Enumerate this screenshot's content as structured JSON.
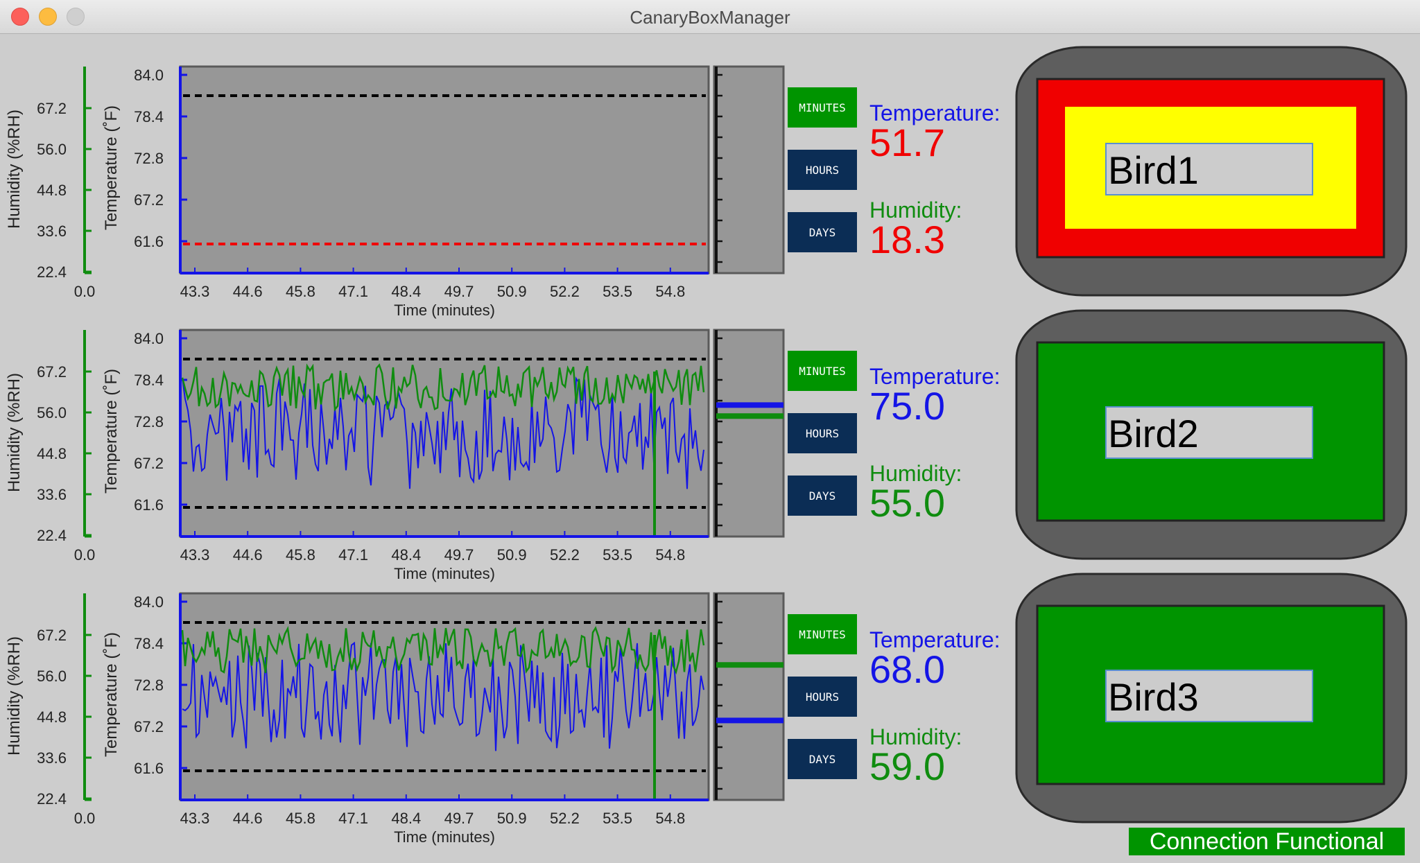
{
  "window": {
    "title": "CanaryBoxManager"
  },
  "axis_labels": {
    "humidity": "Humidity (%RH)",
    "temperature": "Temperature (˚F)",
    "time": "Time (minutes)"
  },
  "axis_ticks": {
    "humidity": [
      "67.2",
      "56.0",
      "44.8",
      "33.6",
      "22.4",
      "0.0"
    ],
    "temperature": [
      "84.0",
      "78.4",
      "72.8",
      "67.2",
      "61.6"
    ],
    "time": [
      "43.3",
      "44.6",
      "45.8",
      "47.1",
      "48.4",
      "49.7",
      "50.9",
      "52.2",
      "53.5",
      "54.8"
    ]
  },
  "range_buttons": {
    "minutes": "MINUTES",
    "hours": "HOURS",
    "days": "DAYS"
  },
  "labels": {
    "temperature": "Temperature:",
    "humidity": "Humidity:"
  },
  "colors": {
    "temperature": "#1414e6",
    "humidity": "#0f8c0f",
    "alarm": "#f00000",
    "warning": "#ffff00",
    "ok": "#009400"
  },
  "birds": [
    {
      "name": "Bird1",
      "temperature": "51.7",
      "humidity": "18.3",
      "status": "alarm",
      "temp_color": "#f00000",
      "humidity_color": "#f00000",
      "has_data": false
    },
    {
      "name": "Bird2",
      "temperature": "75.0",
      "humidity": "55.0",
      "status": "ok",
      "temp_color": "#1414e6",
      "humidity_color": "#0f8c0f",
      "has_data": true
    },
    {
      "name": "Bird3",
      "temperature": "68.0",
      "humidity": "59.0",
      "status": "ok",
      "temp_color": "#1414e6",
      "humidity_color": "#0f8c0f",
      "has_data": true
    }
  ],
  "status": {
    "connection": "Connection Functional"
  }
}
